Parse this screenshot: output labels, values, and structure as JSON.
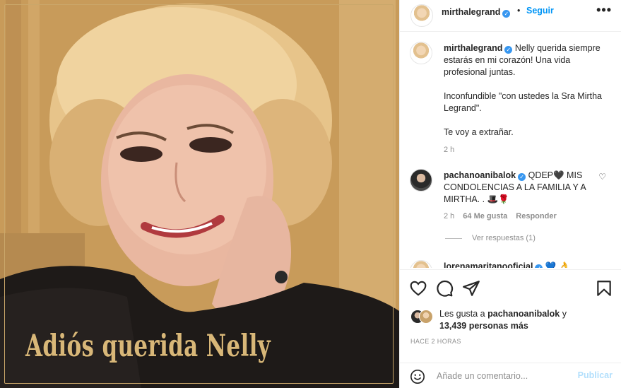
{
  "photo": {
    "caption": "Adiós querida Nelly"
  },
  "header": {
    "username": "mirthalegrand",
    "separator": "•",
    "follow_label": "Seguir",
    "more_label": "•••"
  },
  "caption_comment": {
    "username": "mirthalegrand",
    "lines": [
      "Nelly querida siempre estarás en mi corazón! Una vida profesional juntas.",
      "Inconfundible \"con ustedes la Sra Mirtha Legrand\".",
      "Te voy a extrañar."
    ],
    "time": "2 h"
  },
  "comments": [
    {
      "username": "pachanoanibalok",
      "text": "QDEP🖤 MIS CONDOLENCIAS A LA FAMILIA Y A MIRTHA. . 🎩🌹",
      "time": "2 h",
      "likes": "64 Me gusta",
      "reply_label": "Responder",
      "view_replies": "Ver respuestas (1)"
    },
    {
      "username": "lorenamaritanooficial",
      "text": "💙 👌"
    }
  ],
  "likes": {
    "prefix": "Les gusta a",
    "user": "pachanoanibalok",
    "and": "y",
    "others": "13,439 personas más"
  },
  "post_time": "HACE 2 HORAS",
  "add_comment": {
    "placeholder": "Añade un comentario...",
    "publish_label": "Publicar"
  }
}
